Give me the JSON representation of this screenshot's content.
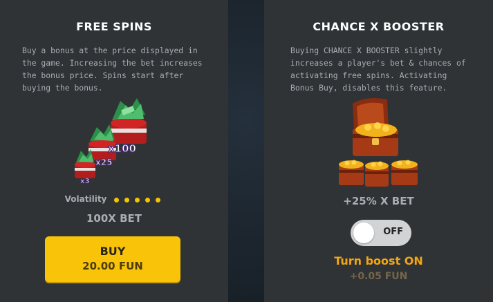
{
  "free_spins": {
    "title": "FREE SPINS",
    "description": "Buy a bonus at the price displayed in the game. Increasing the bet increases the bonus price. Spins start after buying the bonus.",
    "multipliers": [
      "x3",
      "x25",
      "x100"
    ],
    "volatility_label": "Volatility",
    "volatility_level": 5,
    "bet_label": "100X BET",
    "buy_label": "BUY",
    "buy_price": "20.00 FUN"
  },
  "chance_booster": {
    "title": "CHANCE X BOOSTER",
    "description": "Buying CHANCE X BOOSTER slightly increases a player's bet & chances of activating free spins. Activating Bonus Buy, disables this feature.",
    "bet_label": "+25% X BET",
    "toggle_state": "OFF",
    "boost_label": "Turn boost ON",
    "boost_price": "+0.05 FUN"
  },
  "colors": {
    "accent": "#f9c30a",
    "boost_text": "#f2a611",
    "panel": "#2f3336"
  }
}
